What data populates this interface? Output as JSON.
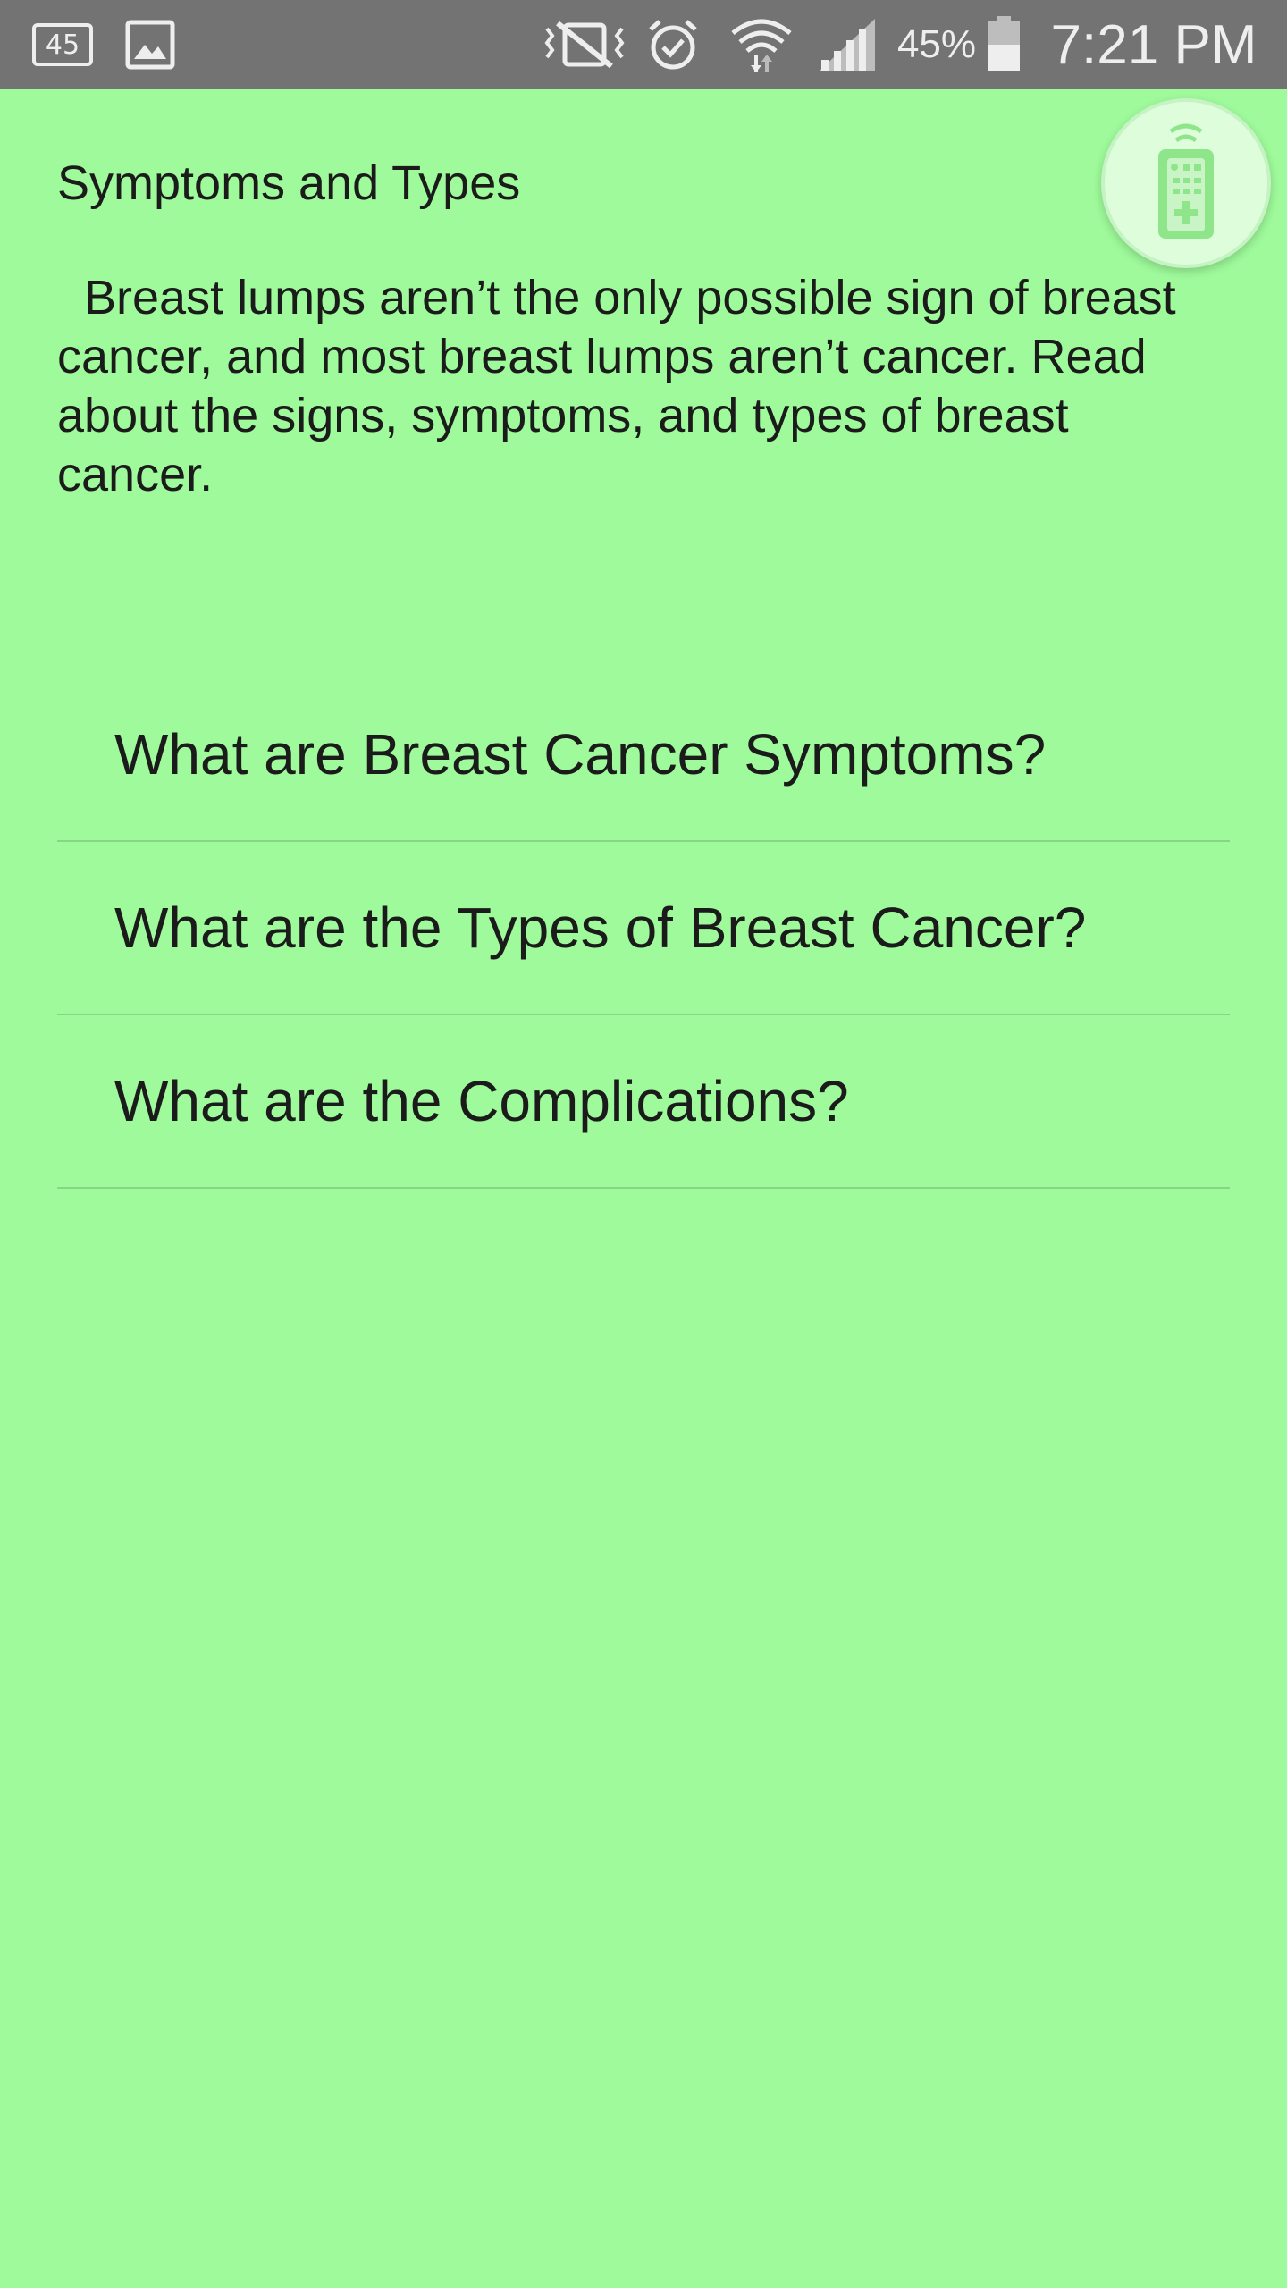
{
  "status_bar": {
    "notification_badge": "45",
    "battery_percent": "45%",
    "time": "7:21 PM",
    "icons": [
      "notification-45-icon",
      "image-icon",
      "vibrate-mute-icon",
      "alarm-icon",
      "wifi-icon",
      "signal-icon",
      "battery-icon"
    ]
  },
  "fab": {
    "icon": "remote-control-icon"
  },
  "page": {
    "title": "Symptoms and Types",
    "description": "  Breast lumps aren’t the only possible sign of breast cancer, and most breast lumps aren’t cancer. Read about the signs, symptoms, and types of breast cancer."
  },
  "topics": [
    {
      "label": "What are Breast Cancer Symptoms?"
    },
    {
      "label": "What are the Types of Breast Cancer?"
    },
    {
      "label": "What are the Complications?"
    }
  ],
  "colors": {
    "background": "#9efa9a",
    "status_bar": "#737373",
    "divider": "#87d684",
    "text": "#1b1b1b"
  }
}
